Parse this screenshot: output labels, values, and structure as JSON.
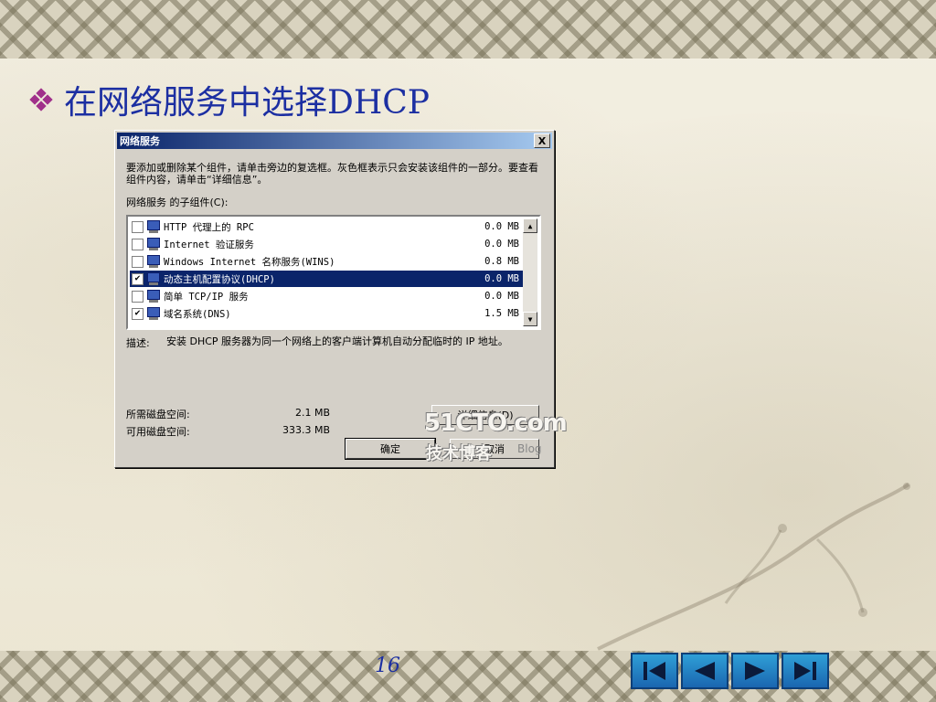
{
  "slide": {
    "heading": "在网络服务中选择DHCP",
    "page_number": "16"
  },
  "dialog": {
    "title": "网络服务",
    "close_label": "X",
    "description": "要添加或删除某个组件，请单击旁边的复选框。灰色框表示只会安装该组件的一部分。要查看组件内容，请单击“详细信息”。",
    "components_label": "网络服务 的子组件(C):",
    "components": [
      {
        "name": "HTTP 代理上的 RPC",
        "size": "0.0 MB",
        "checked": false,
        "selected": false
      },
      {
        "name": "Internet 验证服务",
        "size": "0.0 MB",
        "checked": false,
        "selected": false
      },
      {
        "name": "Windows Internet 名称服务(WINS)",
        "size": "0.8 MB",
        "checked": false,
        "selected": false
      },
      {
        "name": "动态主机配置协议(DHCP)",
        "size": "0.0 MB",
        "checked": true,
        "selected": true
      },
      {
        "name": "简单 TCP/IP 服务",
        "size": "0.0 MB",
        "checked": false,
        "selected": false
      },
      {
        "name": "域名系统(DNS)",
        "size": "1.5 MB",
        "checked": true,
        "selected": false
      }
    ],
    "check_mark": "✔",
    "details_label": "描述:",
    "details_text": "安装 DHCP 服务器为同一个网络上的客户端计算机自动分配临时的 IP 地址。",
    "disk_required_label": "所需磁盘空间:",
    "disk_required_value": "2.1 MB",
    "disk_free_label": "可用磁盘空间:",
    "disk_free_value": "333.3 MB",
    "details_button": "详细信息(D)",
    "ok_button": "确定",
    "cancel_button": "取消"
  },
  "watermark": {
    "main": "51CTO.com",
    "sub": "技术博客",
    "blog": "Blog"
  },
  "icons": {
    "bullet": "diamond-bullet-icon",
    "component": "network-computer-icon",
    "nav_first": "first-slide-icon",
    "nav_prev": "previous-slide-icon",
    "nav_next": "next-slide-icon",
    "nav_last": "last-slide-icon"
  },
  "colors": {
    "heading": "#1c2fa2",
    "bullet": "#a0308a",
    "titlebar": "#0a246a",
    "selection": "#0a246a",
    "nav": "#1a66b0"
  }
}
